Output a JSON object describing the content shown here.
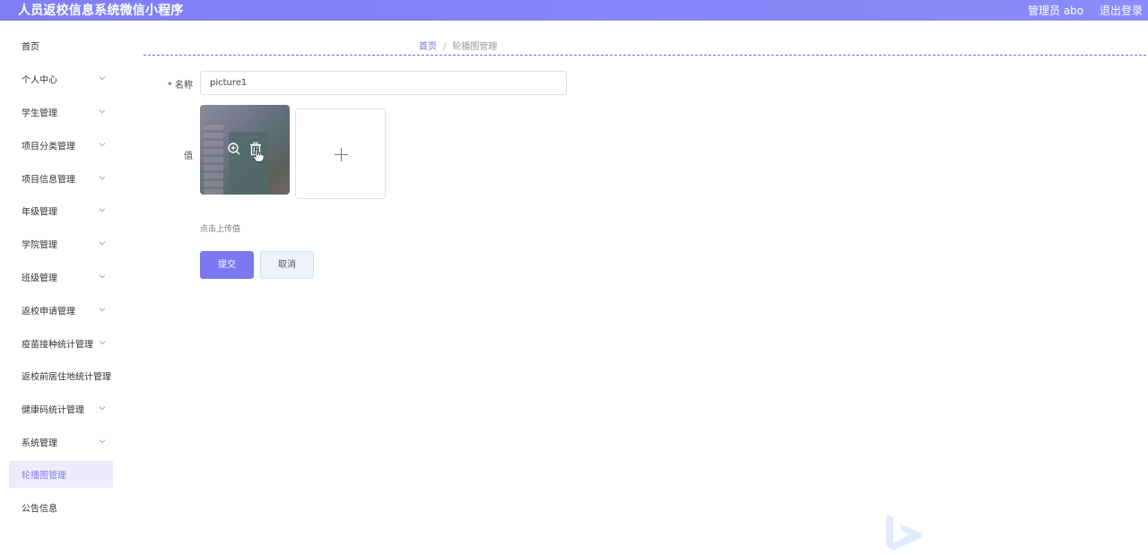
{
  "app": {
    "title": "人员返校信息系统微信小程序"
  },
  "header": {
    "user_label": "管理员 abo",
    "logout_label": "退出登录"
  },
  "sidebar": {
    "items": [
      {
        "label": "首页",
        "has_chevron": false,
        "active": false
      },
      {
        "label": "个人中心",
        "has_chevron": true,
        "active": false
      },
      {
        "label": "学生管理",
        "has_chevron": true,
        "active": false
      },
      {
        "label": "项目分类管理",
        "has_chevron": true,
        "active": false
      },
      {
        "label": "项目信息管理",
        "has_chevron": true,
        "active": false
      },
      {
        "label": "年级管理",
        "has_chevron": true,
        "active": false
      },
      {
        "label": "学院管理",
        "has_chevron": true,
        "active": false
      },
      {
        "label": "班级管理",
        "has_chevron": true,
        "active": false
      },
      {
        "label": "返校申请管理",
        "has_chevron": true,
        "active": false
      },
      {
        "label": "疫苗接种统计管理",
        "has_chevron": true,
        "active": false
      },
      {
        "label": "返校前居住地统计管理",
        "has_chevron": false,
        "active": false
      },
      {
        "label": "健康码统计管理",
        "has_chevron": true,
        "active": false
      },
      {
        "label": "系统管理",
        "has_chevron": true,
        "active": false
      },
      {
        "label": "轮播图管理",
        "has_chevron": false,
        "active": true
      },
      {
        "label": "公告信息",
        "has_chevron": false,
        "active": false
      }
    ]
  },
  "breadcrumb": {
    "home": "首页",
    "separator": "/",
    "current": "轮播图管理"
  },
  "form": {
    "name_label": "* 名称",
    "name_value": "picture1",
    "value_label": "值",
    "upload_hint": "点击上传值",
    "submit_label": "提交",
    "cancel_label": "取消"
  },
  "colors": {
    "accent": "#7f7ef5",
    "active_bg": "#edecfc",
    "active_text": "#8a7cf0"
  }
}
